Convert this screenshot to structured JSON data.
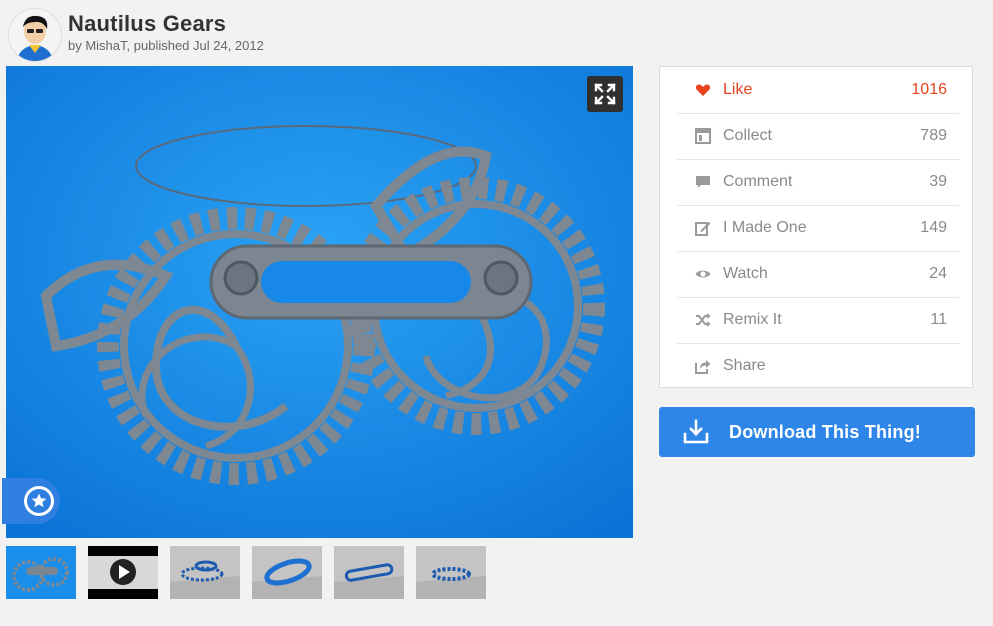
{
  "thing": {
    "title": "Nautilus Gears",
    "byline_prefix": "by ",
    "author": "MishaT",
    "published": ", published Jul 24, 2012"
  },
  "actions": [
    {
      "label": "Like",
      "count": "1016",
      "icon": "heart-icon"
    },
    {
      "label": "Collect",
      "count": "789",
      "icon": "collect-icon"
    },
    {
      "label": "Comment",
      "count": "39",
      "icon": "comment-icon"
    },
    {
      "label": "I Made One",
      "count": "149",
      "icon": "made-one-icon"
    },
    {
      "label": "Watch",
      "count": "24",
      "icon": "eye-icon"
    },
    {
      "label": "Remix It",
      "count": "11",
      "icon": "shuffle-icon"
    },
    {
      "label": "Share",
      "count": "",
      "icon": "share-icon"
    }
  ],
  "download": {
    "label": "Download This Thing!",
    "icon": "download-icon"
  },
  "colors": {
    "like": "#e8431c",
    "accent": "#2e87e8",
    "photo_bg": "#1a8ee8"
  },
  "thumbnails": [
    {
      "kind": "photo"
    },
    {
      "kind": "video"
    },
    {
      "kind": "render"
    },
    {
      "kind": "render"
    },
    {
      "kind": "render"
    },
    {
      "kind": "render"
    }
  ]
}
